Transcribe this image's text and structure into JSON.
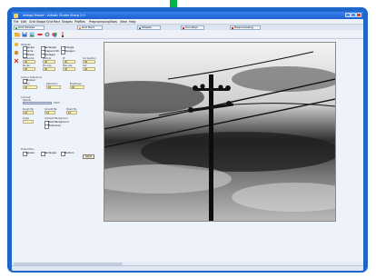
{
  "window": {
    "title": "ImageJ Helper - Artistic Studio Sharp 2.0"
  },
  "menubar": {
    "items": [
      "File",
      "Edit",
      "Grid Shape",
      "Grid Rect",
      "Shapes",
      "Profiles",
      "Preprocessing",
      "Tools",
      "View",
      "Help"
    ]
  },
  "tabs": {
    "items": [
      {
        "label": "Grid Shapes",
        "color": "#28a745"
      },
      {
        "label": "Grid Rect",
        "color": "#e89b1a"
      },
      {
        "label": "Shapes",
        "color": "#2a7ad6"
      },
      {
        "label": "Sun Rays",
        "color": "#c62828"
      },
      {
        "label": "Preprocessing",
        "color": "#c62828"
      }
    ]
  },
  "params": {
    "section_title": "Objects",
    "shape_options": [
      "Square",
      "Rectangle",
      "Triangle",
      "Circle",
      "Diagonal Str.",
      "Hexagon",
      "Ellipse",
      "Pentagon"
    ],
    "fields_row1": [
      {
        "label": "Horizontal",
        "value": "40"
      },
      {
        "label": "Vertical",
        "value": "40"
      },
      {
        "label": "W",
        "value": "40"
      },
      {
        "label": "Cut position",
        "value": "40"
      }
    ],
    "fields_row2": [
      {
        "label": "Border",
        "value": "40"
      },
      {
        "label": "Min size",
        "value": "40"
      },
      {
        "label": "Max size",
        "value": "40"
      },
      {
        "label": "Out",
        "value": "40"
      }
    ],
    "colors_section": "Colour tolerance",
    "colors_checkbox": "Manual",
    "colors_fields": [
      {
        "label": "Colour",
        "value": "40"
      },
      {
        "label": "Saturation",
        "value": "40"
      },
      {
        "label": "Brightness",
        "value": "40"
      }
    ],
    "cutout_label": "Cut-out",
    "opacity_label": "Opacity",
    "opacity_value": "100%",
    "small_fields": [
      {
        "label": "Rough flip",
        "value": "10"
      },
      {
        "label": "Smooth flip",
        "value": "10"
      },
      {
        "label": "Sharp flip",
        "value": "10"
      }
    ],
    "angle_label": "Angle",
    "gradient_label": "Gradient Background",
    "gradient_options": [
      "Solid Background",
      "Multicolour"
    ],
    "proportion_label": "Proportion",
    "proportion_options": [
      "Square",
      "Rectangle",
      "Medium"
    ],
    "apply_label": "Apply"
  },
  "canvas": {
    "label": "output",
    "description_icon": "power-line-photo"
  }
}
